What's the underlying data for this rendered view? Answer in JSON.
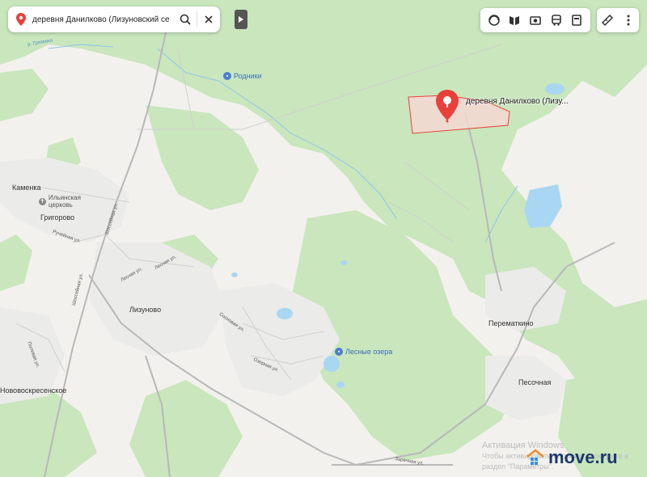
{
  "search": {
    "query": "деревня Данилково (Лизуновский се",
    "search_icon": "search-icon",
    "clear_icon": "close-icon"
  },
  "toolbar": {
    "buttons": [
      "layers-icon",
      "panorama-icon",
      "photo-icon",
      "transit-icon",
      "traffic-icon"
    ],
    "extra": [
      "ruler-icon",
      "more-icon"
    ]
  },
  "marker": {
    "label": "деревня Данилково (Лизу..."
  },
  "places": {
    "kamenka": "Каменка",
    "church": "Ильинская церковь",
    "grigorovo": "Григорово",
    "lizunovo": "Лизуново",
    "novovoskresenskoe": "Нововоскресенское",
    "permatkino": "Перематкино",
    "pesochnaya": "Песочная"
  },
  "pois": {
    "rodniki": "Родники",
    "lesnye_ozera": "Лесные озера"
  },
  "streets": {
    "griazevka": "р. Грязевка",
    "ruchejnaya": "Ручейная ул.",
    "shosseynaya": "Шоссейная ул.",
    "lesnaya1": "Лесная ул.",
    "lesnaya2": "Лесная ул.",
    "shosseynaya2": "Шоссейная ул.",
    "polevaya": "Полевая ул.",
    "sosnovaya": "Сосновая ул.",
    "ozernaya": "Озерная ул.",
    "zarechnaya": "Заречная ул."
  },
  "watermark": {
    "line1": "Активация Windows",
    "line2": "Чтобы активировать Windows, перейдите в",
    "line3": "раздел \"Параметры\"."
  },
  "brand": {
    "name": "move.ru"
  },
  "colors": {
    "forest": "#c7e7bd",
    "urban": "#ececea",
    "water": "#a9d6f2",
    "accent_red": "#e8403a",
    "polygon_fill": "#f4d7d2"
  }
}
